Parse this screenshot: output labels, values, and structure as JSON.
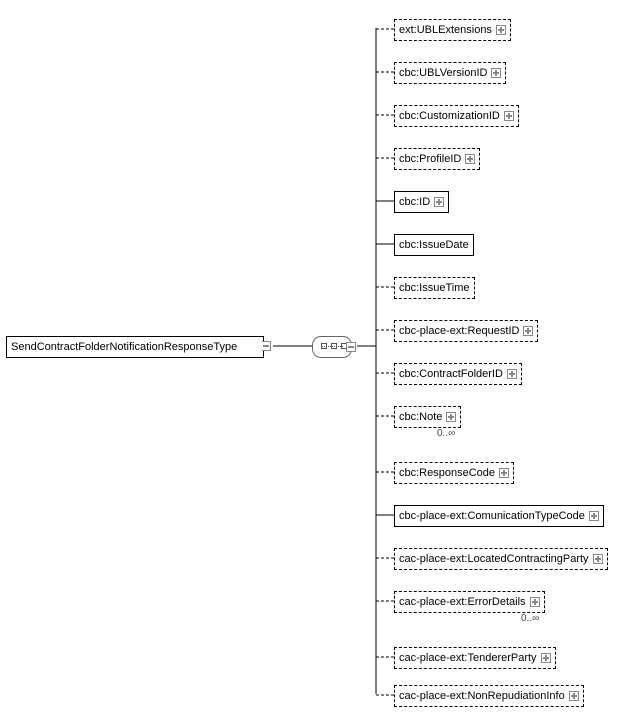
{
  "root": {
    "label": "SendContractFolderNotificationResponseType"
  },
  "children": [
    {
      "label": "ext:UBLExtensions",
      "optional": true,
      "expand": true
    },
    {
      "label": "cbc:UBLVersionID",
      "optional": true,
      "expand": true
    },
    {
      "label": "cbc:CustomizationID",
      "optional": true,
      "expand": true
    },
    {
      "label": "cbc:ProfileID",
      "optional": true,
      "expand": true
    },
    {
      "label": "cbc:ID",
      "optional": false,
      "expand": true
    },
    {
      "label": "cbc:IssueDate",
      "optional": false,
      "expand": false
    },
    {
      "label": "cbc:IssueTime",
      "optional": true,
      "expand": false
    },
    {
      "label": "cbc-place-ext:RequestID",
      "optional": true,
      "expand": true
    },
    {
      "label": "cbc:ContractFolderID",
      "optional": true,
      "expand": true
    },
    {
      "label": "cbc:Note",
      "optional": true,
      "expand": true,
      "cardinality": "0..∞"
    },
    {
      "label": "cbc:ResponseCode",
      "optional": true,
      "expand": true
    },
    {
      "label": "cbc-place-ext:ComunicationTypeCode",
      "optional": false,
      "expand": true
    },
    {
      "label": "cac-place-ext:LocatedContractingParty",
      "optional": true,
      "expand": true
    },
    {
      "label": "cac-place-ext:ErrorDetails",
      "optional": true,
      "expand": true,
      "cardinality": "0..∞"
    },
    {
      "label": "cac-place-ext:TendererParty",
      "optional": true,
      "expand": true
    },
    {
      "label": "cac-place-ext:NonRepudiationInfo",
      "optional": true,
      "expand": true
    }
  ],
  "chart_data": {
    "type": "tree",
    "root": "SendContractFolderNotificationResponseType",
    "compositor": "sequence",
    "elements": [
      {
        "name": "ext:UBLExtensions",
        "min": 0,
        "max": 1
      },
      {
        "name": "cbc:UBLVersionID",
        "min": 0,
        "max": 1
      },
      {
        "name": "cbc:CustomizationID",
        "min": 0,
        "max": 1
      },
      {
        "name": "cbc:ProfileID",
        "min": 0,
        "max": 1
      },
      {
        "name": "cbc:ID",
        "min": 1,
        "max": 1
      },
      {
        "name": "cbc:IssueDate",
        "min": 1,
        "max": 1
      },
      {
        "name": "cbc:IssueTime",
        "min": 0,
        "max": 1
      },
      {
        "name": "cbc-place-ext:RequestID",
        "min": 0,
        "max": 1
      },
      {
        "name": "cbc:ContractFolderID",
        "min": 0,
        "max": 1
      },
      {
        "name": "cbc:Note",
        "min": 0,
        "max": "unbounded"
      },
      {
        "name": "cbc:ResponseCode",
        "min": 0,
        "max": 1
      },
      {
        "name": "cbc-place-ext:ComunicationTypeCode",
        "min": 1,
        "max": 1
      },
      {
        "name": "cac-place-ext:LocatedContractingParty",
        "min": 0,
        "max": 1
      },
      {
        "name": "cac-place-ext:ErrorDetails",
        "min": 0,
        "max": "unbounded"
      },
      {
        "name": "cac-place-ext:TendererParty",
        "min": 0,
        "max": 1
      },
      {
        "name": "cac-place-ext:NonRepudiationInfo",
        "min": 0,
        "max": 1
      }
    ]
  }
}
